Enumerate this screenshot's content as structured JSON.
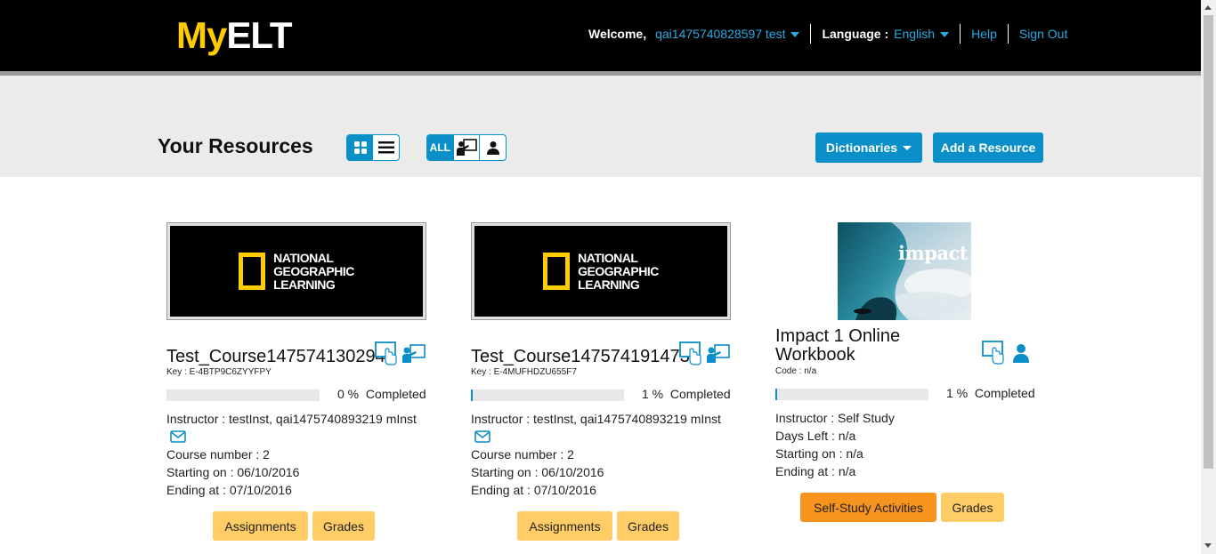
{
  "header": {
    "logo_my": "My",
    "logo_elt": "ELT",
    "welcome_label": "Welcome,",
    "username": "qai1475740828597 test",
    "language_label": "Language :",
    "language_value": "English",
    "help": "Help",
    "sign_out": "Sign Out"
  },
  "toolbar": {
    "title": "Your Resources",
    "filter_all": "ALL",
    "dictionaries": "Dictionaries",
    "add_resource": "Add a Resource"
  },
  "cards": [
    {
      "thumb_text": [
        "NATIONAL",
        "GEOGRAPHIC",
        "LEARNING"
      ],
      "title": "Test_Course1475741302945",
      "key": "Key : E-4BTP9C6ZYYFPY",
      "progress": 0,
      "progress_text": "0 %  Completed",
      "instructor": "Instructor : testInst, qai1475740893219 mInst",
      "course_number": "Course number : 2",
      "starting": "Starting on : 06/10/2016",
      "ending": "Ending at : 07/10/2016",
      "btn1": "Assignments",
      "btn2": "Grades"
    },
    {
      "thumb_text": [
        "NATIONAL",
        "GEOGRAPHIC",
        "LEARNING"
      ],
      "title": "Test_Course1475741914737",
      "key": "Key : E-4MUFHDZU655F7",
      "progress": 1,
      "progress_text": "1 %  Completed",
      "instructor": "Instructor : testInst, qai1475740893219 mInst",
      "course_number": "Course number : 2",
      "starting": "Starting on : 06/10/2016",
      "ending": "Ending at : 07/10/2016",
      "btn1": "Assignments",
      "btn2": "Grades"
    },
    {
      "thumb_text": "impact",
      "title_line1": "Impact 1 Online",
      "title_line2": "Workbook",
      "key": "Code : n/a",
      "progress": 1,
      "progress_text": "1 %  Completed",
      "instructor": "Instructor : Self Study",
      "days_left": "Days Left : n/a",
      "starting": "Starting on : n/a",
      "ending": "Ending at : n/a",
      "btn1": "Self-Study Activities",
      "btn2": "Grades"
    }
  ],
  "colors": {
    "accent": "#0a8fc9",
    "link": "#29abe2",
    "brand_yellow": "#ffcc00",
    "button_yellow": "#ffcc66",
    "button_orange": "#f7941d"
  }
}
